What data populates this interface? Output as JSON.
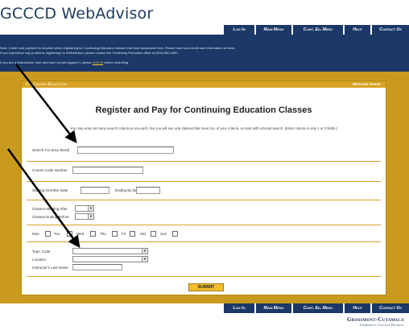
{
  "header": {
    "logo_text": "GCCCD WebAdvisor"
  },
  "nav": {
    "items": [
      {
        "label": "Log In"
      },
      {
        "label": "Main Menu"
      },
      {
        "label": "Cont. Ed. Menu"
      },
      {
        "label": "Help"
      },
      {
        "label": "Contact Us"
      }
    ]
  },
  "notice": {
    "line1": "Note: Credit card payment is required when registering for Continuing Education classes that have associated fees. Please have your credit card information at hand.",
    "line2": "If you experience any problems registering on WebAdvisor, please contact the Continuing Education office at (619) 660-4350.",
    "line3_pre": "If you are a WebAdvisor user and have not yet logged in, please",
    "line3_link": "LOG IN",
    "line3_post": "before searching."
  },
  "panel": {
    "section_title": "Continuing Education",
    "welcome": "Welcome Guest!"
  },
  "form": {
    "title": "Register and Pay for Continuing Education Classes",
    "intro": "You may enter as many search criteria as you wish, but you will see only classes that meet ALL of your criteria, so start with a broad search. (Enter criteria in only 1 or 2 fields.)",
    "search_label": "Search For (Key Word)",
    "course_code_label": "Course Code Number",
    "starting_label": "Starting On/After Date",
    "ending_label": "Ending By Date",
    "meeting_after_label": "Classes Meeting After",
    "ending_before_label": "Classes Ending Before",
    "days": [
      "Mon",
      "Tue",
      "Wed",
      "Thu",
      "Fri",
      "Sat",
      "Sun"
    ],
    "topic_label": "Topic Code",
    "location_label": "Location",
    "instructor_label": "Instructor's Last Name",
    "submit_label": "SUBMIT"
  },
  "footer": {
    "brand_line1": "Grossmont-Cuyamaca",
    "brand_line2": "Community College District"
  },
  "colors": {
    "navy": "#1b3866",
    "mustard": "#c99a1e",
    "panel_header": "#d8a324",
    "submit": "#f3bd2c"
  }
}
